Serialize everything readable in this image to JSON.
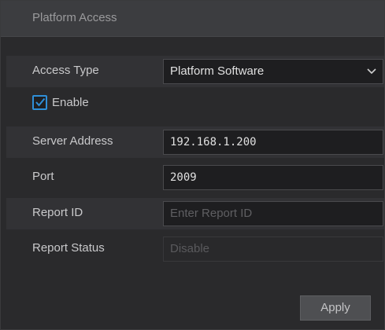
{
  "title": "Platform Access",
  "access_type": {
    "label": "Access Type",
    "value": "Platform Software"
  },
  "enable": {
    "label": "Enable",
    "checked": true
  },
  "server_address": {
    "label": "Server Address",
    "value": "192.168.1.200"
  },
  "port": {
    "label": "Port",
    "value": "2009"
  },
  "report_id": {
    "label": "Report ID",
    "placeholder": "Enter Report ID"
  },
  "report_status": {
    "label": "Report Status",
    "value": "Disable"
  },
  "apply_label": "Apply",
  "icons": {
    "dropdown": "chevron-down-icon",
    "check": "checkmark-icon"
  },
  "colors": {
    "accent": "#2f8fd8"
  }
}
